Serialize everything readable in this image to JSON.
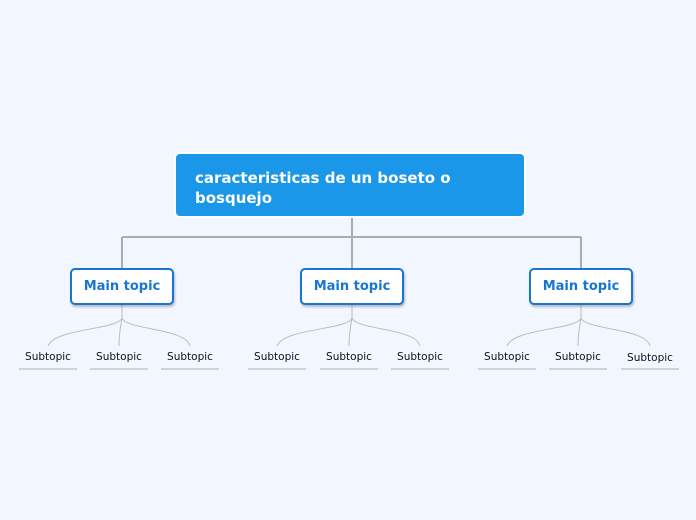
{
  "root": {
    "title": "caracteristicas de un boseto o bosquejo"
  },
  "main_topics": [
    {
      "label": "Main topic",
      "subtopics": [
        "Subtopic",
        "Subtopic",
        "Subtopic"
      ]
    },
    {
      "label": "Main topic",
      "subtopics": [
        "Subtopic",
        "Subtopic",
        "Subtopic"
      ]
    },
    {
      "label": "Main topic",
      "subtopics": [
        "Subtopic",
        "Subtopic",
        "Subtopic"
      ]
    }
  ],
  "colors": {
    "background": "#f2f6fe",
    "root_fill": "#1a97e8",
    "main_border": "#1676d2",
    "connector": "#a9acb0",
    "subtopic_connector": "#b9bcc0"
  }
}
